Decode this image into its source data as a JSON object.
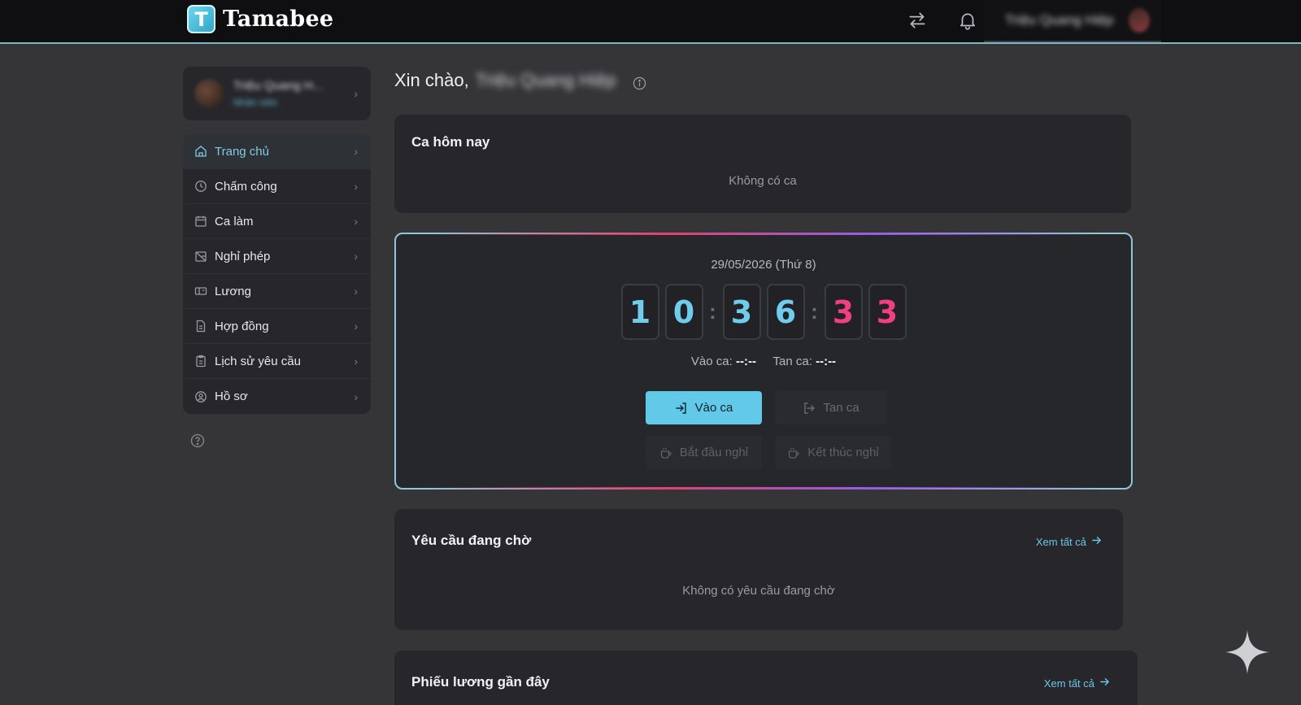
{
  "header": {
    "brand_name": "Tamabee",
    "logo_letter": "T",
    "user_name": "Triệu Quang Hiệp"
  },
  "sidebar": {
    "profile": {
      "name": "Triệu Quang H...",
      "role": "Nhân viên"
    },
    "items": [
      {
        "label": "Trang chủ",
        "icon": "home-icon",
        "active": true
      },
      {
        "label": "Chấm công",
        "icon": "clock-icon"
      },
      {
        "label": "Ca làm",
        "icon": "calendar-icon"
      },
      {
        "label": "Nghỉ phép",
        "icon": "leave-icon"
      },
      {
        "label": "Lương",
        "icon": "salary-icon"
      },
      {
        "label": "Hợp đồng",
        "icon": "document-icon"
      },
      {
        "label": "Lịch sử yêu cầu",
        "icon": "clipboard-icon"
      },
      {
        "label": "Hồ sơ",
        "icon": "user-circle-icon"
      }
    ]
  },
  "main": {
    "greeting": "Xin chào,",
    "greeting_name": "Triệu Quang Hiệp",
    "today": {
      "title": "Ca hôm nay",
      "empty": "Không có ca"
    },
    "clock": {
      "date": "29/05/2026 (Thứ 8)",
      "digits": [
        "1",
        "0",
        "3",
        "6",
        "3",
        "3"
      ],
      "check_in_label": "Vào ca:",
      "check_in_value": "--:--",
      "check_out_label": "Tan ca:",
      "check_out_value": "--:--",
      "btn_check_in": "Vào ca",
      "btn_check_out": "Tan ca",
      "btn_break_start": "Bắt đầu nghỉ",
      "btn_break_end": "Kết thúc nghỉ"
    },
    "pending": {
      "title": "Yêu cầu đang chờ",
      "see_all": "Xem tất cả",
      "empty": "Không có yêu cầu đang chờ"
    },
    "payslips": {
      "title": "Phiếu lương gần đây",
      "see_all": "Xem tất cả"
    }
  },
  "colors": {
    "accent": "#63c9e8",
    "seconds": "#f0407f",
    "background": "#353538",
    "card": "#27272b"
  }
}
